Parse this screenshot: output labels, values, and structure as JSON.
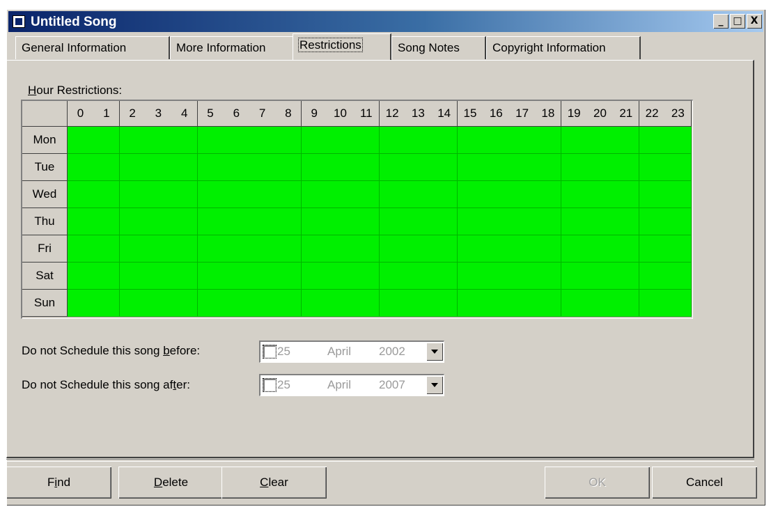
{
  "window": {
    "title": "Untitled Song",
    "controls": {
      "minimize": "_",
      "maximize": "□",
      "close": "X"
    }
  },
  "tabs": [
    {
      "label": "General Information",
      "active": false
    },
    {
      "label": "More Information",
      "active": false
    },
    {
      "label": "Restrictions",
      "active": true
    },
    {
      "label": "Song Notes",
      "active": false
    },
    {
      "label": "Copyright Information",
      "active": false
    }
  ],
  "restrictions": {
    "hour_label_prefix": "H",
    "hour_label_rest": "our Restrictions:",
    "hours": [
      "0",
      "1",
      "2",
      "3",
      "4",
      "5",
      "6",
      "7",
      "8",
      "9",
      "10",
      "11",
      "12",
      "13",
      "14",
      "15",
      "16",
      "17",
      "18",
      "19",
      "20",
      "21",
      "22",
      "23"
    ],
    "days": [
      "Mon",
      "Tue",
      "Wed",
      "Thu",
      "Fri",
      "Sat",
      "Sun"
    ],
    "allowed_color": "#00f000",
    "all_allowed": true
  },
  "before": {
    "label_pre": "Do not Schedule this song ",
    "label_accel": "b",
    "label_post": "efore:",
    "day": "25",
    "month": "April",
    "year": "2002",
    "checked": false
  },
  "after": {
    "label_pre": "Do not Schedule this song af",
    "label_accel": "t",
    "label_post": "er:",
    "day": "25",
    "month": "April",
    "year": "2007",
    "checked": false
  },
  "buttons": {
    "find_pre": "F",
    "find_accel": "i",
    "find_post": "nd",
    "delete_accel": "D",
    "delete_post": "elete",
    "clear_accel": "C",
    "clear_post": "lear",
    "ok": "OK",
    "cancel": "Cancel"
  }
}
